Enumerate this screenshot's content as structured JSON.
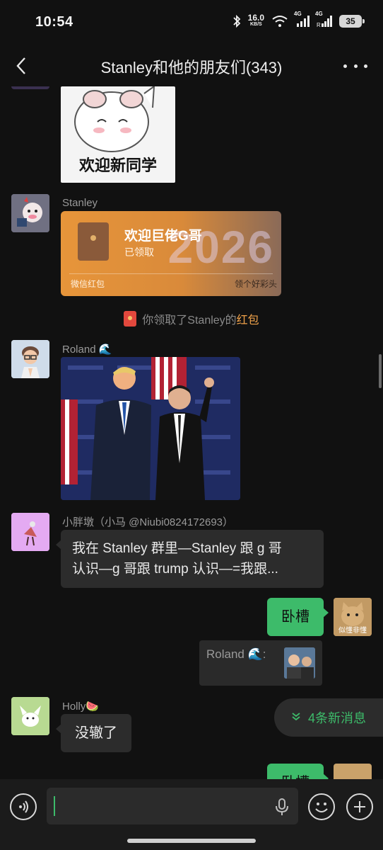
{
  "status": {
    "time": "10:54",
    "net_speed": "16.0",
    "net_unit": "KB/S",
    "signal1": "4G",
    "signal2": "4G",
    "battery": "35"
  },
  "header": {
    "title": "Stanley和他的朋友们(343)"
  },
  "messages": {
    "sticker_text": "欢迎新同学",
    "stanley_name": "Stanley",
    "redpacket": {
      "title": "欢迎巨佬G哥",
      "status": "已领取",
      "footer": "微信红包",
      "tip": "领个好彩头",
      "year": "2026"
    },
    "sys_prefix": "你领取了Stanley的",
    "sys_highlight": "红包",
    "roland_name": "Roland 🌊",
    "xiaopang_name": "小胖墩（小马 @Niubi0824172693）",
    "xiaopang_text1": "我在 Stanley 群里—Stanley 跟 g 哥",
    "xiaopang_text2": "认识—g 哥跟 trump 认识—=我跟...",
    "my_text": "卧槽",
    "my_avatar_caption": "似懂非懂",
    "quote_label": "Roland 🌊:",
    "holly_name": "Holly🍉",
    "holly_text": "没辙了",
    "my_text_partial": "卧槽"
  },
  "new_messages": "4条新消息",
  "input": {
    "placeholder": ""
  },
  "colors": {
    "accent_green": "#3dbb6a",
    "bubble_dark": "#2c2c2c",
    "background": "#111111",
    "highlight_orange": "#f0a24a"
  }
}
